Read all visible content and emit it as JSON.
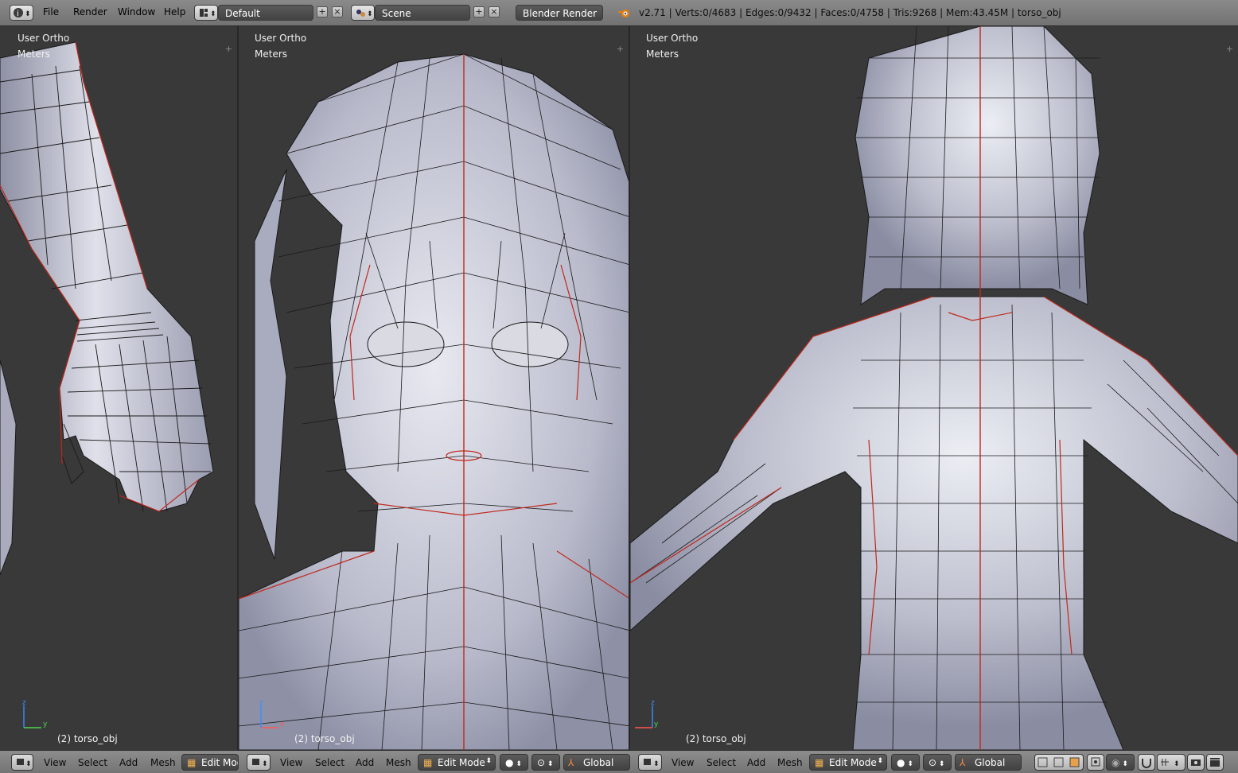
{
  "topbar": {
    "menus": [
      "File",
      "Render",
      "Window",
      "Help"
    ],
    "layout_value": "Default",
    "scene_value": "Scene",
    "engine_value": "Blender Render",
    "status_text": "v2.71 | Verts:0/4683 | Edges:0/9432 | Faces:0/4758 | Tris:9268 | Mem:43.45M | torso_obj"
  },
  "viewports": [
    {
      "view_name": "User Ortho",
      "units": "Meters",
      "object_label": "(2) torso_obj"
    },
    {
      "view_name": "User Ortho",
      "units": "Meters",
      "object_label": "(2) torso_obj"
    },
    {
      "view_name": "User Ortho",
      "units": "Meters",
      "object_label": "(2) torso_obj"
    }
  ],
  "headers": [
    {
      "menus": [
        "View",
        "Select",
        "Add",
        "Mesh"
      ],
      "mode": "Edit Mode"
    },
    {
      "menus": [
        "View",
        "Select",
        "Add",
        "Mesh"
      ],
      "mode": "Edit Mode",
      "orientation": "Global"
    },
    {
      "menus": [
        "View",
        "Select",
        "Add",
        "Mesh"
      ],
      "mode": "Edit Mode",
      "orientation": "Global"
    }
  ],
  "axes": {
    "left": [
      "z",
      "y"
    ],
    "middle": [
      "z",
      "x"
    ],
    "right": [
      "z",
      "y"
    ]
  },
  "colors": {
    "viewport_bg": "#393939",
    "mesh_fill": "#b6b8c8",
    "mesh_wire": "#1a1a1a",
    "seam": "#c0281c",
    "header_bg": "#7d7d7d"
  }
}
